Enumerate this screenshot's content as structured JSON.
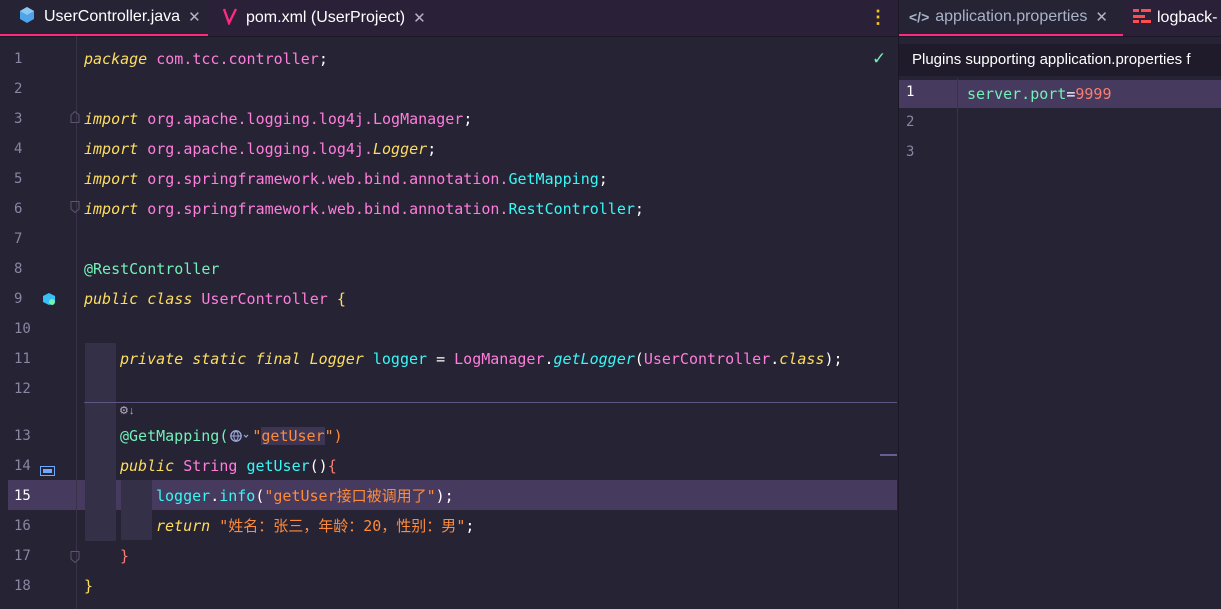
{
  "editor_left": {
    "tabs": [
      {
        "label": "UserController.java",
        "icon": "java-class-icon"
      },
      {
        "label": "pom.xml (UserProject)",
        "icon": "maven-icon"
      }
    ],
    "close_glyph": "✕",
    "more_glyph": "⋮",
    "check_glyph": "✓",
    "hint_glyph": "⚙↓",
    "line_numbers": [
      "1",
      "2",
      "3",
      "4",
      "5",
      "6",
      "7",
      "8",
      "9",
      "10",
      "11",
      "12",
      "13",
      "14",
      "15",
      "16",
      "17",
      "18"
    ],
    "code": {
      "l1_kw": "package",
      "l1_pkg": "com.tcc.controller",
      "semi": ";",
      "import_kw": "import",
      "l3_pkg": "org.apache.logging.log4j.",
      "l3_cls": "LogManager",
      "l4_pkg": "org.apache.logging.log4j.",
      "l4_cls": "Logger",
      "l5_pkg": "org.springframework.web.bind.annotation.",
      "l5_cls": "GetMapping",
      "l6_pkg": "org.springframework.web.bind.annotation.",
      "l6_cls": "RestController",
      "l8_ann": "@RestController",
      "l9_kw": "public class",
      "l9_cls": "UserController",
      "l9_brace": "{",
      "l11_kw": "private static final",
      "l11_type": "Logger",
      "l11_var": "logger",
      "l11_eq": "=",
      "l11_mgr": "LogManager",
      "l11_dot": ".",
      "l11_fn": "getLogger",
      "l11_open": "(",
      "l11_arg": "UserController",
      "l11_cls_kw": "class",
      "l11_close": ");",
      "l13_ann": "@GetMapping(",
      "l13_str_open": "\"",
      "l13_str": "getUser",
      "l13_str_close": "\")",
      "l14_kw": "public",
      "l14_type": "String",
      "l14_fn": "getUser",
      "l14_paren": "()",
      "l14_brace": "{",
      "l15_var": "logger",
      "l15_dot": ".",
      "l15_fn": "info",
      "l15_open": "(",
      "l15_str": "\"getUser接口被调用了\"",
      "l15_close": ");",
      "l16_kw": "return",
      "l16_str": "\"姓名：张三，年龄：20，性别：男\"",
      "l16_semi": ";",
      "l17_brace": "}",
      "l18_brace": "}"
    }
  },
  "editor_right": {
    "tabs": [
      {
        "label": "application.properties",
        "icon": "properties-icon"
      },
      {
        "label": "logback-",
        "icon": "xml-config-icon"
      }
    ],
    "close_glyph": "✕",
    "banner": "Plugins supporting application.properties f",
    "line_numbers": [
      "1",
      "2",
      "3"
    ],
    "property_key": "server.port",
    "property_eq": "=",
    "property_value": "9999"
  },
  "colors": {
    "background": "#262335",
    "tab_accent": "#ff2a7f",
    "keyword": "#fede5d",
    "package": "#ff7edb",
    "class": "#36f9f6",
    "annotation": "#72f1b8",
    "string": "#ff8b39",
    "current_line": "#463a5e"
  }
}
